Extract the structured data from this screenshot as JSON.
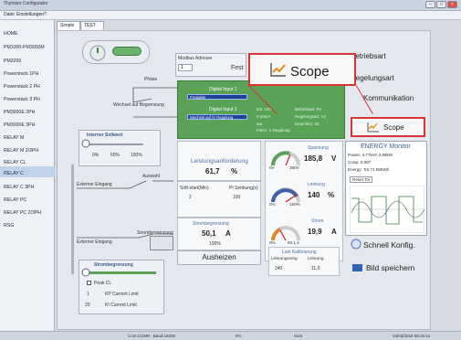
{
  "window": {
    "title": "Thyristor Configurator"
  },
  "menu": {
    "items": [
      "Datei",
      "Einstellungen",
      "?"
    ]
  },
  "sidebar": {
    "items": [
      {
        "label": "HOME"
      },
      {
        "label": "PM1000-PM3000M"
      },
      {
        "label": "PM3200"
      },
      {
        "label": "Powerstack 1PH"
      },
      {
        "label": "Powerstack 2 PH"
      },
      {
        "label": "Powerstack 3 PH"
      },
      {
        "label": "PM3000E 2PH"
      },
      {
        "label": "PM3000E 3PH"
      },
      {
        "label": "RELAY M"
      },
      {
        "label": "RELAY M 2/3PH"
      },
      {
        "label": "RELAY CL"
      },
      {
        "label": "RELAY C"
      },
      {
        "label": "RELAY C 3PH"
      },
      {
        "label": "RELAY PC"
      },
      {
        "label": "RELAY PC 2/3PH"
      },
      {
        "label": "RSG"
      }
    ],
    "selected": "RELAY C"
  },
  "tabs": [
    {
      "label": "Simple"
    },
    {
      "label": "TEST"
    }
  ],
  "left_panel": {
    "phase_label": "Phäse",
    "verhalten": "Wechsel auf Begrenzung",
    "soft_label": "Interner Sollwert",
    "pct_labels": [
      "0%",
      "50%",
      "100%"
    ],
    "externer_eingang": "Externer Eingang",
    "begrenzung_label": "Strombegrenzung",
    "check_label": "Peak CL",
    "field1_val": "1",
    "field1_label": "KP Current Limit",
    "field2_val": "20",
    "field2_label": "KI Current Limit"
  },
  "modbus": {
    "label": "Modbus Adresse",
    "value": "1",
    "extra": "Fest"
  },
  "green_box": {
    "title1": "Digital Input 1",
    "field1": "Freigabe",
    "title2": "Digital Input 2",
    "field2": "Wechsel auf IV Regelung",
    "side": [
      "Ext. Ctrl.",
      "0-20mA",
      "Sw.",
      "Intern. V Regelung"
    ],
    "right": [
      "Betriebsart: PA",
      "Regelungsart: V2",
      "Datenfeld: 3G"
    ]
  },
  "leistung": {
    "label": "Leistungsanforderung",
    "value": "61,7",
    "unit": "%"
  },
  "sollwert": {
    "label": "Soft-start(Min)",
    "value": "2",
    "label2": "PI Senkung(s)",
    "value2": "100"
  },
  "strom": {
    "label": "Strombegrenzung",
    "value": "50,1",
    "unit": "A",
    "sub": "100%"
  },
  "ausheizen": "Ausheizen",
  "last_kal": {
    "label": "Last Kalibrierung",
    "sub1": "Leistungsverg",
    "sub2": "Leistung",
    "val1": "240",
    "val2": "11,0"
  },
  "gauges": [
    {
      "name": "Spannung",
      "value": "185,8",
      "unit": "V",
      "min": "0V",
      "max": "380V"
    },
    {
      "name": "Leistung",
      "value": "140",
      "unit": "%",
      "min": "0%",
      "max": "150%"
    },
    {
      "name": "Strom",
      "value": "19,9",
      "unit": "A",
      "min": "0%",
      "max": "50,1 A"
    }
  ],
  "right_menu": {
    "items": [
      "Betriebsart",
      "Regelungsart",
      "Kommunikation"
    ],
    "scope": "Scope",
    "schnell": "Schnell Konfig.",
    "bild": "Bild speichern"
  },
  "energy": {
    "title": "ENERGY Monitor",
    "lines": [
      "Power: 3.77kVA  3.86kW",
      "Cosφ: 0.987",
      "Energy: Tot 71 565Wh"
    ],
    "reset": "Reset Tot"
  },
  "popup": {
    "label": "Scope"
  },
  "statusbar": {
    "left": "Com:COM8 - Baud:19200",
    "mid1": "0%",
    "mid2": "SUS",
    "right": "04/03/2018 08:26:21"
  },
  "colors": {
    "accent_red": "#d93434",
    "panel_green": "#5aa256",
    "selected_blue": "#bfd2ea"
  }
}
